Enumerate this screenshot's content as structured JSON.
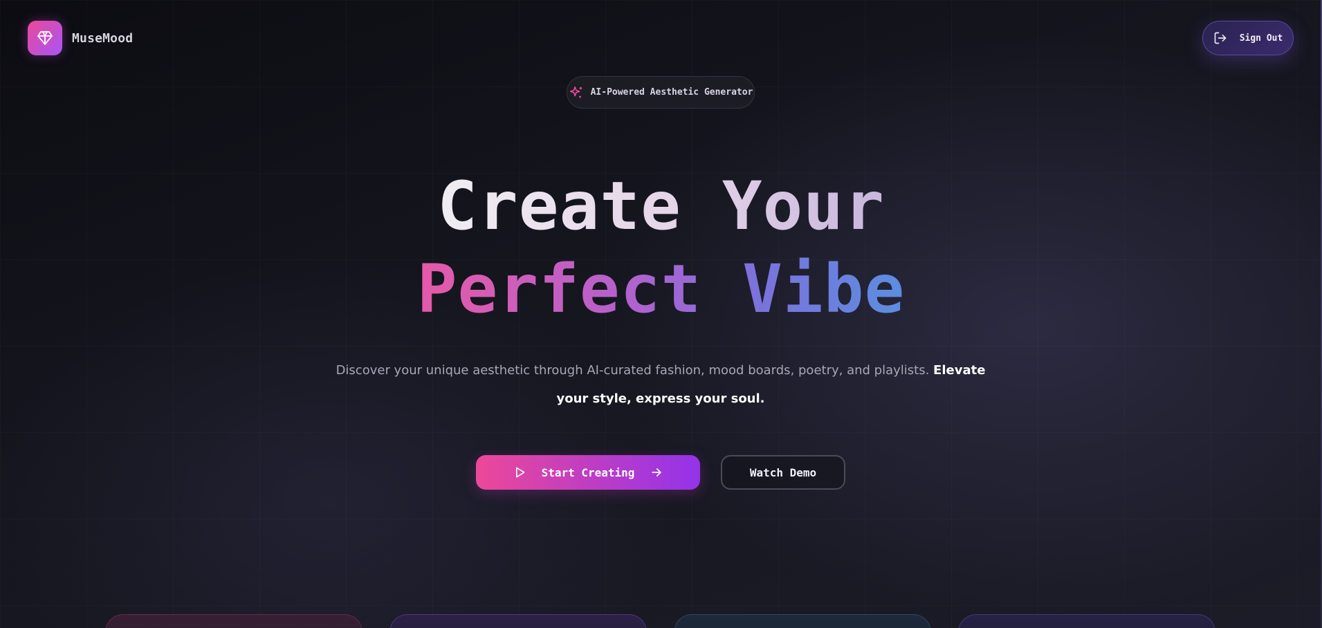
{
  "brand": {
    "name": "MuseMood",
    "logo_icon": "diamond-icon",
    "gradient": [
      "#ec4899",
      "#a855f7"
    ]
  },
  "header": {
    "signout_label": "Sign Out",
    "signout_icon": "log-out-icon"
  },
  "badge": {
    "label": "AI-Powered Aesthetic Generator",
    "icon": "sparkles-icon"
  },
  "hero": {
    "line1": "Create Your",
    "line2": "Perfect Vibe",
    "description": "Discover your unique aesthetic through AI-curated fashion, mood boards, poetry, and playlists.",
    "description_emphasis": "Elevate your style, express your soul."
  },
  "cta": {
    "primary_label": "Start Creating",
    "primary_icon_left": "play-icon",
    "primary_icon_right": "arrow-right-icon",
    "secondary_label": "Watch Demo"
  },
  "cards": [
    {
      "id": "card-1"
    },
    {
      "id": "card-2"
    },
    {
      "id": "card-3"
    },
    {
      "id": "card-4"
    }
  ],
  "colors": {
    "background": "#14141c",
    "accent_pink": "#ec4899",
    "accent_purple": "#9333ea",
    "accent_blue": "#5b8ee0"
  }
}
